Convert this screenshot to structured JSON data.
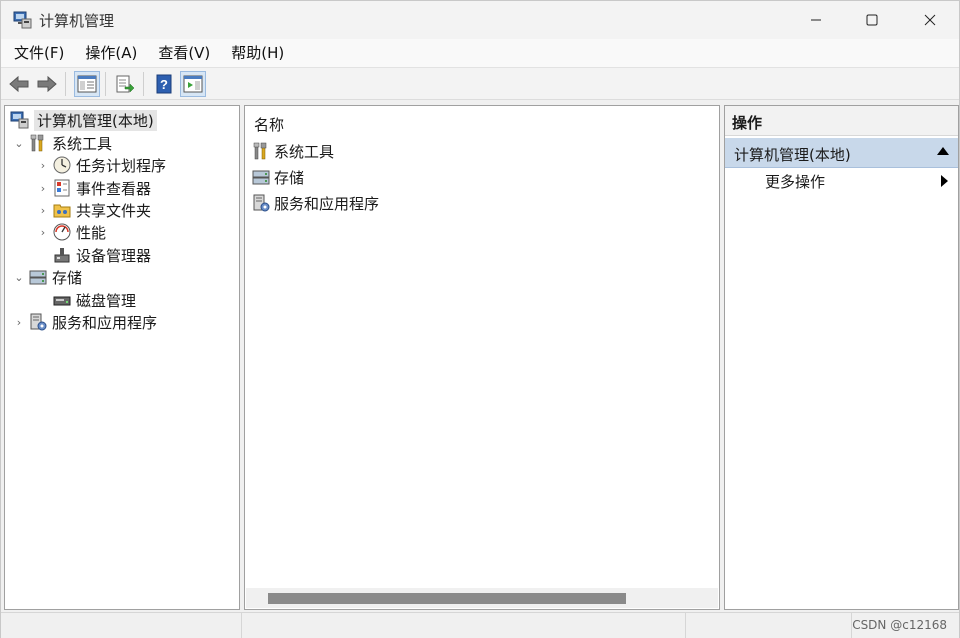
{
  "window": {
    "title": "计算机管理",
    "controls": {
      "minimize": "—",
      "maximize": "☐",
      "close": "✕"
    }
  },
  "menu": {
    "items": [
      "文件(F)",
      "操作(A)",
      "查看(V)",
      "帮助(H)"
    ]
  },
  "toolbar": {
    "buttons": [
      "back-arrow-icon",
      "forward-arrow-icon",
      "show-hide-console-tree-icon",
      "export-list-icon",
      "help-icon",
      "show-hide-action-pane-icon"
    ]
  },
  "tree": {
    "root": "计算机管理(本地)",
    "items": [
      {
        "label": "系统工具",
        "icon": "tools-icon",
        "chevron": "⌄"
      },
      {
        "label": "任务计划程序",
        "icon": "clock-icon",
        "chevron": "›"
      },
      {
        "label": "事件查看器",
        "icon": "event-viewer-icon",
        "chevron": "›"
      },
      {
        "label": "共享文件夹",
        "icon": "shared-folder-icon",
        "chevron": "›"
      },
      {
        "label": "性能",
        "icon": "performance-icon",
        "chevron": "›"
      },
      {
        "label": "设备管理器",
        "icon": "device-manager-icon",
        "chevron": ""
      },
      {
        "label": "存储",
        "icon": "storage-icon",
        "chevron": "⌄"
      },
      {
        "label": "磁盘管理",
        "icon": "disk-icon",
        "chevron": ""
      },
      {
        "label": "服务和应用程序",
        "icon": "services-icon",
        "chevron": "›"
      }
    ]
  },
  "list": {
    "column_header": "名称",
    "items": [
      {
        "label": "系统工具",
        "icon": "tools-icon"
      },
      {
        "label": "存储",
        "icon": "storage-icon"
      },
      {
        "label": "服务和应用程序",
        "icon": "services-icon"
      }
    ]
  },
  "actions": {
    "header": "操作",
    "section": "计算机管理(本地)",
    "items": [
      "更多操作"
    ]
  },
  "status": {
    "watermark": "CSDN @c12168"
  },
  "colors": {
    "selection_bg": "#e5e5e5",
    "action_section_bg": "#c8d8ea",
    "scroll_thumb": "#8a8a8a"
  }
}
